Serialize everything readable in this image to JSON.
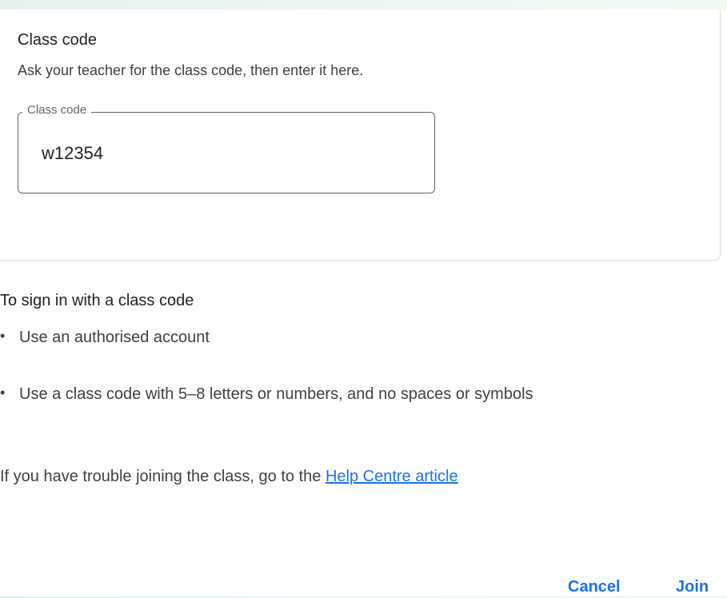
{
  "code_card": {
    "title": "Class code",
    "subtitle": "Ask your teacher for the class code, then enter it here.",
    "field_label": "Class code",
    "field_value": "w12354"
  },
  "instructions": {
    "title": "To sign in with a class code",
    "bullet_symbol": "•",
    "bullets": [
      "Use an authorised account",
      "Use a class code with 5–8 letters or numbers, and no spaces or symbols"
    ]
  },
  "help": {
    "prefix": "If you have trouble joining the class, go to the ",
    "link_text": "Help Centre article"
  },
  "actions": {
    "cancel_label": "Cancel",
    "join_label": "Join"
  },
  "colors": {
    "accent": "#1a73e8",
    "text": "#202124",
    "secondary_text": "#3c4043",
    "border": "#dadce0"
  }
}
